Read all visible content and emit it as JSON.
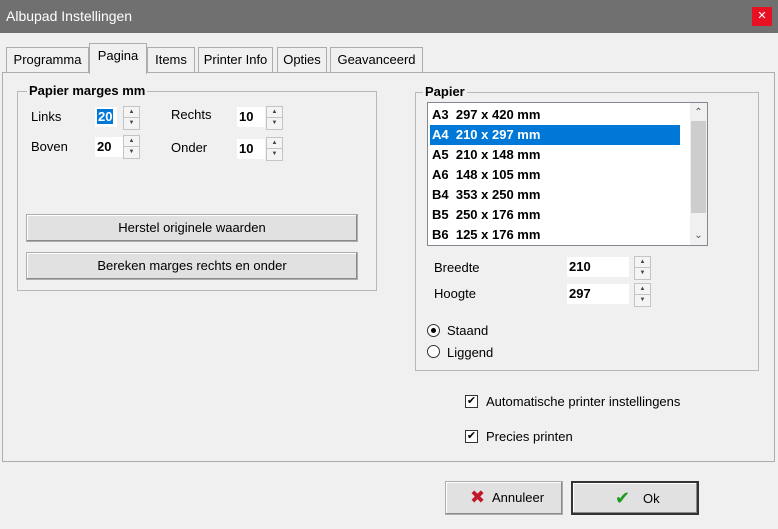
{
  "window": {
    "title": "Albupad Instellingen",
    "close_glyph": "✕"
  },
  "tabs": [
    {
      "label": "Programma"
    },
    {
      "label": "Pagina",
      "active": true
    },
    {
      "label": "Items"
    },
    {
      "label": "Printer Info"
    },
    {
      "label": "Opties"
    },
    {
      "label": "Geavanceerd"
    }
  ],
  "margins": {
    "title": "Papier marges mm",
    "left_label": "Links",
    "left_value": "20",
    "right_label": "Rechts",
    "right_value": "10",
    "top_label": "Boven",
    "top_value": "20",
    "bottom_label": "Onder",
    "bottom_value": "10",
    "restore_button": "Herstel originele waarden",
    "calc_button": "Bereken marges rechts en onder"
  },
  "paper": {
    "title": "Papier",
    "items": [
      "A3  297 x 420 mm",
      "A4  210 x 297 mm",
      "A5  210 x 148 mm",
      "A6  148 x 105 mm",
      "B4  353 x 250 mm",
      "B5  250 x 176 mm",
      "B6  125 x 176 mm"
    ],
    "selected_index": 1,
    "width_label": "Breedte",
    "width_value": "210",
    "height_label": "Hoogte",
    "height_value": "297",
    "portrait_label": "Staand",
    "landscape_label": "Liggend",
    "orientation": "portrait"
  },
  "options": {
    "auto_printer_label": "Automatische printer instellingens",
    "auto_printer_checked": true,
    "precise_label": "Precies printen",
    "precise_checked": true
  },
  "footer": {
    "cancel_label": "Annuleer",
    "ok_label": "Ok"
  },
  "colors": {
    "selection": "#0078d7",
    "cancel_icon": "#c0182a",
    "ok_icon": "#1e9a1e"
  },
  "icons": {
    "cancel": "x-icon",
    "ok": "checkmark-icon",
    "spin_up": "▲",
    "spin_down": "▼",
    "scroll_up": "⌃",
    "scroll_down": "⌄",
    "check": "✔",
    "cross": "✖"
  }
}
